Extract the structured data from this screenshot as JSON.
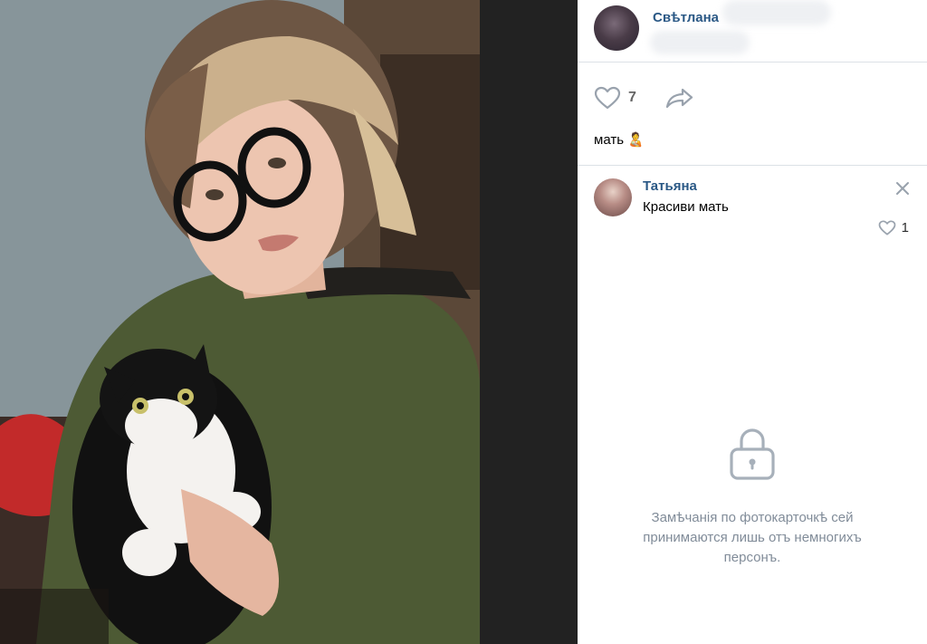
{
  "author": {
    "name": "Свѣтлана"
  },
  "post": {
    "likes": "7",
    "caption": "мать",
    "caption_emoji": "🧑‍🍼"
  },
  "comment": {
    "author": "Татьяна",
    "text": "Красиви мать",
    "likes": "1"
  },
  "restricted": {
    "message": "Замѣчанія по фотокарточкѣ сей принимаются лишь отъ немногихъ персонъ."
  },
  "icons": {
    "like": "heart-icon",
    "share": "share-arrow-icon",
    "close": "close-icon",
    "lock": "lock-icon"
  },
  "colors": {
    "link": "#2a5885",
    "muted": "#818c99",
    "divider": "#dce1e6",
    "icon": "#99a2ad"
  }
}
